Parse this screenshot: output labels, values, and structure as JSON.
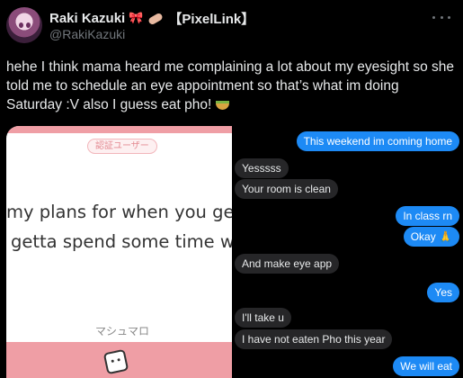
{
  "author": {
    "display_name": "Raki Kazuki",
    "name_tag": "【PixelLink】",
    "handle": "@RakiKazuki",
    "avatar_icon": "avatar-icon",
    "name_emojis": [
      "ribbon-emoji",
      "bandage-emoji"
    ]
  },
  "tweet": {
    "text": "hehe I think mama heard me complaining a lot about my eyesight so she told me to schedule an eye appointment so that’s what im doing Saturday :V also I guess eat pho!",
    "trailing_emoji": "pho-bowl-emoji"
  },
  "more_icon": "more-horizontal-icon",
  "left_image": {
    "badge": "認証ユーザー",
    "question_line_1": "my plans for when you get ho",
    "question_line_2": "getta spend some time with",
    "brand": "マシュマロ",
    "brand_icon": "marshmallow-icon",
    "colors": {
      "accent_pink": "#ef9ea5"
    }
  },
  "chat": {
    "colors": {
      "outgoing": "#1d8af5",
      "incoming": "#262628"
    },
    "messages": [
      {
        "text": "This weekend im coming home",
        "side": "out"
      },
      {
        "text": "Yesssss",
        "side": "in"
      },
      {
        "text": "Your room is clean",
        "side": "in"
      },
      {
        "text": "In class rn",
        "side": "out"
      },
      {
        "text": "Okay 🙏",
        "side": "out"
      },
      {
        "text": "And make eye app",
        "side": "in"
      },
      {
        "text": "Yes",
        "side": "out"
      },
      {
        "text": "I'll take u",
        "side": "in"
      },
      {
        "text": "I have not eaten Pho this year",
        "side": "in"
      },
      {
        "text": "We will eat",
        "side": "out"
      }
    ]
  }
}
